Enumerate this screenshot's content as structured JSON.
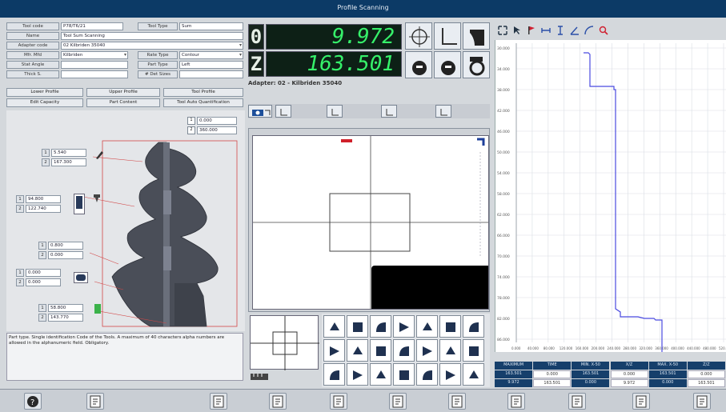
{
  "window": {
    "title": "Profile Scanning"
  },
  "form": {
    "rows": [
      {
        "label": "Tool code",
        "value": "P78/T6/21",
        "label2": "Tool Type",
        "value2": "Sum"
      },
      {
        "label": "Name",
        "value": "Tool Sum Scanning"
      },
      {
        "label": "Adapter code",
        "value": "02 Kilbriden 35040"
      },
      {
        "label": "Mfr. Mfd",
        "value": "Kilbriden",
        "label2": "Rate Type",
        "value2": "Contour"
      },
      {
        "label": "Stat Angle",
        "value": "",
        "label2": "Part Type",
        "value2": "Left"
      },
      {
        "label": "Thick S.",
        "value": "",
        "label2": "# Det Sizes",
        "value2": ""
      }
    ],
    "buttons_row1": [
      "Lower Profile",
      "Upper Profile",
      "Tool Profile"
    ],
    "buttons_row2": [
      "Edit Capacity",
      "Part Content",
      "Tool Auto Quantification"
    ]
  },
  "diagram": {
    "top_values": [
      "0.000",
      "360.000"
    ],
    "left_values": [
      {
        "n": "1",
        "v": "5.540",
        "n2": "2",
        "v2": "167.300"
      },
      {
        "n": "1",
        "v": "94.800",
        "n2": "2",
        "v2": "122.740"
      },
      {
        "n": "1",
        "v": "0.800",
        "n2": "2",
        "v2": "0.000"
      },
      {
        "n": "1",
        "v": "0.000",
        "n2": "2",
        "v2": "0.000"
      },
      {
        "n": "1",
        "v": "58.800",
        "n2": "2",
        "v2": "143.770"
      }
    ]
  },
  "status_text": "Part type. Single identification Code of the Tools. A maximum of 40 characters alpha numbers are allowed in the alphanumeric field. Obligatory.",
  "dro": {
    "x_axis": "0",
    "x_value": "9.972",
    "z_axis": "Z",
    "z_value": "163.501"
  },
  "adapter_label": "Adapter: 02 - Kilbriden 35040",
  "graph": {
    "y_ticks": [
      "30.000",
      "34.000",
      "38.000",
      "42.000",
      "46.000",
      "50.000",
      "54.000",
      "58.000",
      "62.000",
      "66.000",
      "70.000",
      "74.000",
      "78.000",
      "82.000",
      "86.000"
    ],
    "x_ticks": [
      "0.000",
      "40.000",
      "80.000",
      "120.000",
      "160.000",
      "200.000",
      "240.000",
      "280.000",
      "320.000",
      "360.000",
      "400.000",
      "440.000",
      "480.000",
      "520.000"
    ]
  },
  "stats": {
    "row1": [
      "MAXIMUM",
      "TIME",
      "MIN. X-50",
      "X/Z",
      "MAX. X-50",
      "Z/Z"
    ],
    "row2": [
      "163.501",
      "0.000",
      "163.501",
      "0.000",
      "163.501",
      "0.000"
    ],
    "row3": [
      "9.972",
      "163.501",
      "0.000",
      "9.972",
      "0.000",
      "163.501"
    ]
  },
  "icons": {
    "bottom": [
      "help-icon",
      "tool-info-icon",
      "probe-icon",
      "document-icon",
      "settings-gear-icon",
      "measure-icon",
      "back-arrow-icon",
      "print-icon",
      "file-icon",
      "save-icon",
      "exit-icon"
    ]
  },
  "colors": {
    "titlebar": "#0c3a66",
    "dro_digits": "#36f06a",
    "profile_line": "#4a4ae0",
    "part_fill": "#4a4e58"
  }
}
